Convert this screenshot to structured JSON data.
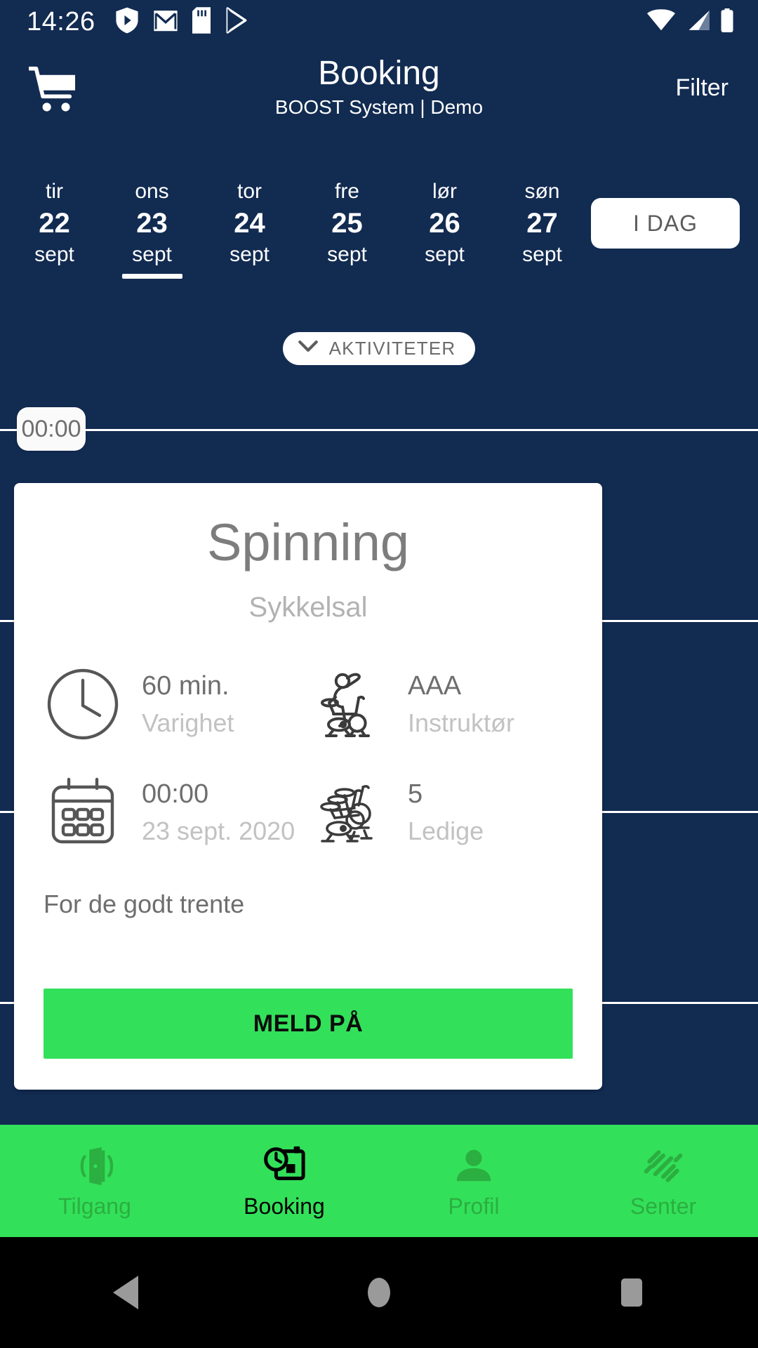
{
  "theme": {
    "navy": "#122B51",
    "green": "#33E05A",
    "nav_green": "#33E05A",
    "nav_inactive": "#2BAF40",
    "white": "#FFFFFF"
  },
  "status_bar": {
    "time": "14:26",
    "left_icons": [
      "shield-play-icon",
      "gmail-icon",
      "sd-card-icon",
      "play-store-icon"
    ],
    "right_icons": [
      "wifi-icon",
      "cellular-signal-icon",
      "battery-icon"
    ]
  },
  "app_bar": {
    "cart_icon": "shopping-cart-icon",
    "title": "Booking",
    "subtitle": "BOOST System | Demo",
    "filter_label": "Filter"
  },
  "date_strip": {
    "days": [
      {
        "dow": "tir",
        "num": "22",
        "mon": "sept",
        "selected": false
      },
      {
        "dow": "ons",
        "num": "23",
        "mon": "sept",
        "selected": true
      },
      {
        "dow": "tor",
        "num": "24",
        "mon": "sept",
        "selected": false
      },
      {
        "dow": "fre",
        "num": "25",
        "mon": "sept",
        "selected": false
      },
      {
        "dow": "lør",
        "num": "26",
        "mon": "sept",
        "selected": false
      },
      {
        "dow": "søn",
        "num": "27",
        "mon": "sept",
        "selected": false
      }
    ],
    "today_label": "I DAG"
  },
  "activities_chip": {
    "label": "AKTIVITETER",
    "icon": "chevron-down-icon"
  },
  "timeline": {
    "first_time": "00:00"
  },
  "class_card": {
    "title": "Spinning",
    "subtitle": "Sykkelsal",
    "info": [
      {
        "icon": "clock-icon",
        "main": "60 min.",
        "sub": "Varighet"
      },
      {
        "icon": "spin-rider-icon",
        "main": "AAA",
        "sub": "Instruktør"
      },
      {
        "icon": "calendar-icon",
        "main": "00:00",
        "sub": "23 sept. 2020"
      },
      {
        "icon": "spin-bikes-icon",
        "main": "5",
        "sub": "Ledige"
      }
    ],
    "description": "For de godt trente",
    "cta_label": "MELD PÅ"
  },
  "bottom_nav": {
    "items": [
      {
        "icon": "door-access-icon",
        "label": "Tilgang",
        "active": false
      },
      {
        "icon": "calendar-clock-icon",
        "label": "Booking",
        "active": true
      },
      {
        "icon": "person-icon",
        "label": "Profil",
        "active": false
      },
      {
        "icon": "dumbbell-icon",
        "label": "Senter",
        "active": false
      }
    ]
  },
  "android_nav": {
    "back_label": "Back",
    "home_label": "Home",
    "recents_label": "Recents"
  }
}
